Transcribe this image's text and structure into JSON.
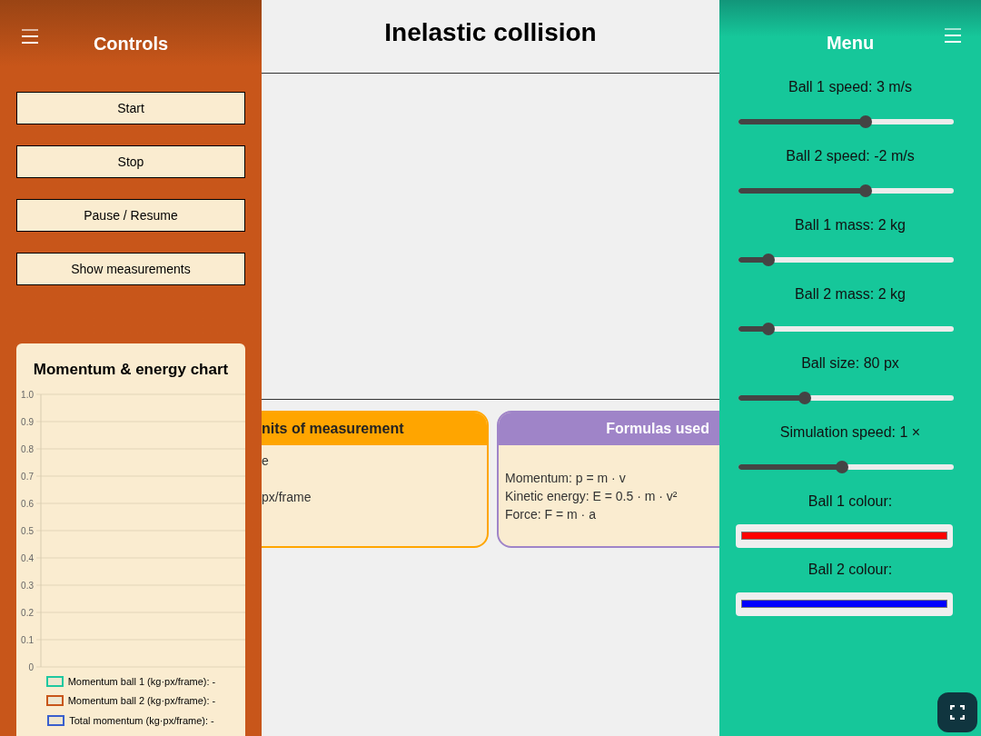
{
  "title": "Inelastic collision",
  "controls": {
    "title": "Controls",
    "buttons": [
      "Start",
      "Stop",
      "Pause / Resume",
      "Show measurements"
    ],
    "chart": {
      "title": "Momentum & energy chart",
      "chart_data": {
        "type": "line",
        "grid": true,
        "ylim": [
          0,
          1
        ],
        "yticks": [
          {
            "value": 0,
            "label": "0"
          },
          {
            "value": 0.1,
            "label": "0.1"
          },
          {
            "value": 0.2,
            "label": "0.2"
          },
          {
            "value": 0.3,
            "label": "0.3"
          },
          {
            "value": 0.4,
            "label": "0.4"
          },
          {
            "value": 0.5,
            "label": "0.5"
          },
          {
            "value": 0.6,
            "label": "0.6"
          },
          {
            "value": 0.7,
            "label": "0.7"
          },
          {
            "value": 0.8,
            "label": "0.8"
          },
          {
            "value": 0.9,
            "label": "0.9"
          },
          {
            "value": 1,
            "label": "1.0"
          }
        ],
        "series": [
          {
            "name": "Momentum ball 1 (kg·px/frame): -",
            "color": "#1fc8a0"
          },
          {
            "name": "Momentum ball 2 (kg·px/frame): -",
            "color": "#c8561a"
          },
          {
            "name": "Total momentum (kg·px/frame): -",
            "color": "#3a5fcd"
          }
        ]
      }
    }
  },
  "cards": [
    {
      "title": "nits of measurement",
      "lines": [
        "e",
        "px/frame"
      ],
      "color": "#ffa500"
    },
    {
      "title": "Formulas used",
      "lines": [
        "Momentum: p = m · v",
        "Kinetic energy: E = 0.5 · m · v²",
        "Force: F = m · a"
      ],
      "color": "#9f84c8"
    }
  ],
  "menu": {
    "title": "Menu",
    "items": [
      {
        "kind": "slider",
        "label": "Ball 1 speed: 3 m/s",
        "level": 0.59
      },
      {
        "kind": "slider",
        "label": "Ball 2 speed: -2 m/s",
        "level": 0.59
      },
      {
        "kind": "slider",
        "label": "Ball 1 mass: 2 kg",
        "level": 0.14
      },
      {
        "kind": "slider",
        "label": "Ball 2 mass: 2 kg",
        "level": 0.14
      },
      {
        "kind": "slider",
        "label": "Ball size: 80 px",
        "level": 0.31
      },
      {
        "kind": "slider",
        "label": "Simulation speed: 1 ×",
        "level": 0.48
      },
      {
        "kind": "colour",
        "label": "Ball 1 colour:",
        "color": "#ff0000"
      },
      {
        "kind": "colour",
        "label": "Ball 2 colour:",
        "color": "#0000ff"
      }
    ]
  }
}
